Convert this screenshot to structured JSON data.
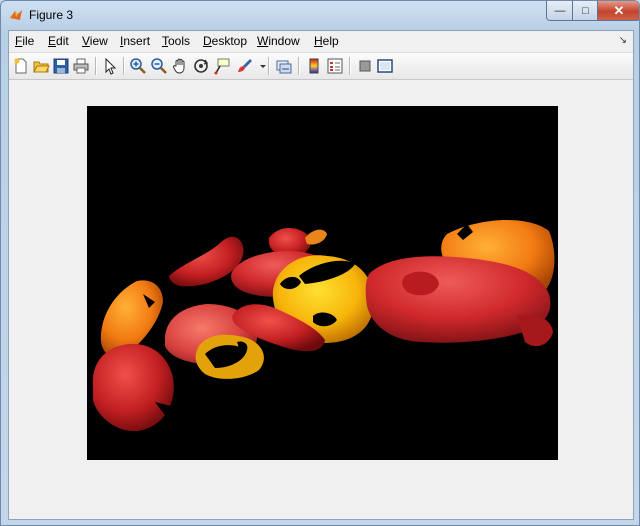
{
  "window": {
    "title": "Figure 3"
  },
  "controls": {
    "minimize": "—",
    "maximize": "□",
    "close": "✕"
  },
  "menu": [
    {
      "key": "F",
      "rest": "ile"
    },
    {
      "key": "E",
      "rest": "dit"
    },
    {
      "key": "V",
      "rest": "iew"
    },
    {
      "key": "I",
      "rest": "nsert"
    },
    {
      "key": "T",
      "rest": "ools"
    },
    {
      "key": "D",
      "rest": "esktop"
    },
    {
      "key": "W",
      "rest": "indow"
    },
    {
      "key": "H",
      "rest": "elp"
    }
  ],
  "dock_icon": "↘",
  "toolbar": {
    "icons": [
      "new-figure-icon",
      "open-file-icon",
      "save-icon",
      "print-icon",
      "edit-plot-arrow-icon",
      "zoom-in-icon",
      "zoom-out-icon",
      "pan-hand-icon",
      "rotate-3d-icon",
      "data-cursor-icon",
      "brush-icon",
      "link-plot-icon",
      "insert-colorbar-icon",
      "insert-legend-icon",
      "hide-plot-tools-icon",
      "show-plot-tools-icon"
    ]
  },
  "colors": {
    "axes_bg": "#000000",
    "client_bg": "#f0f0f0"
  }
}
